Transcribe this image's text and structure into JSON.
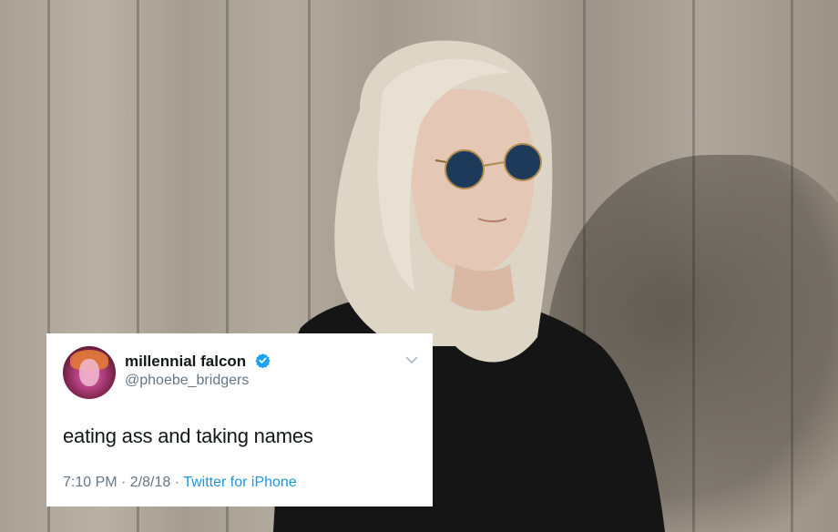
{
  "tweet": {
    "display_name": "millennial falcon",
    "handle": "@phoebe_bridgers",
    "text": "eating ass and taking names",
    "time_date": "7:10 PM · 2/8/18 · ",
    "source": "Twitter for iPhone"
  },
  "icons": {
    "verified": "verified-badge-icon",
    "chevron": "chevron-down-icon"
  },
  "colors": {
    "link": "#1b95e0",
    "verified": "#1da1f2",
    "text": "#14171a",
    "secondary": "#657786"
  }
}
